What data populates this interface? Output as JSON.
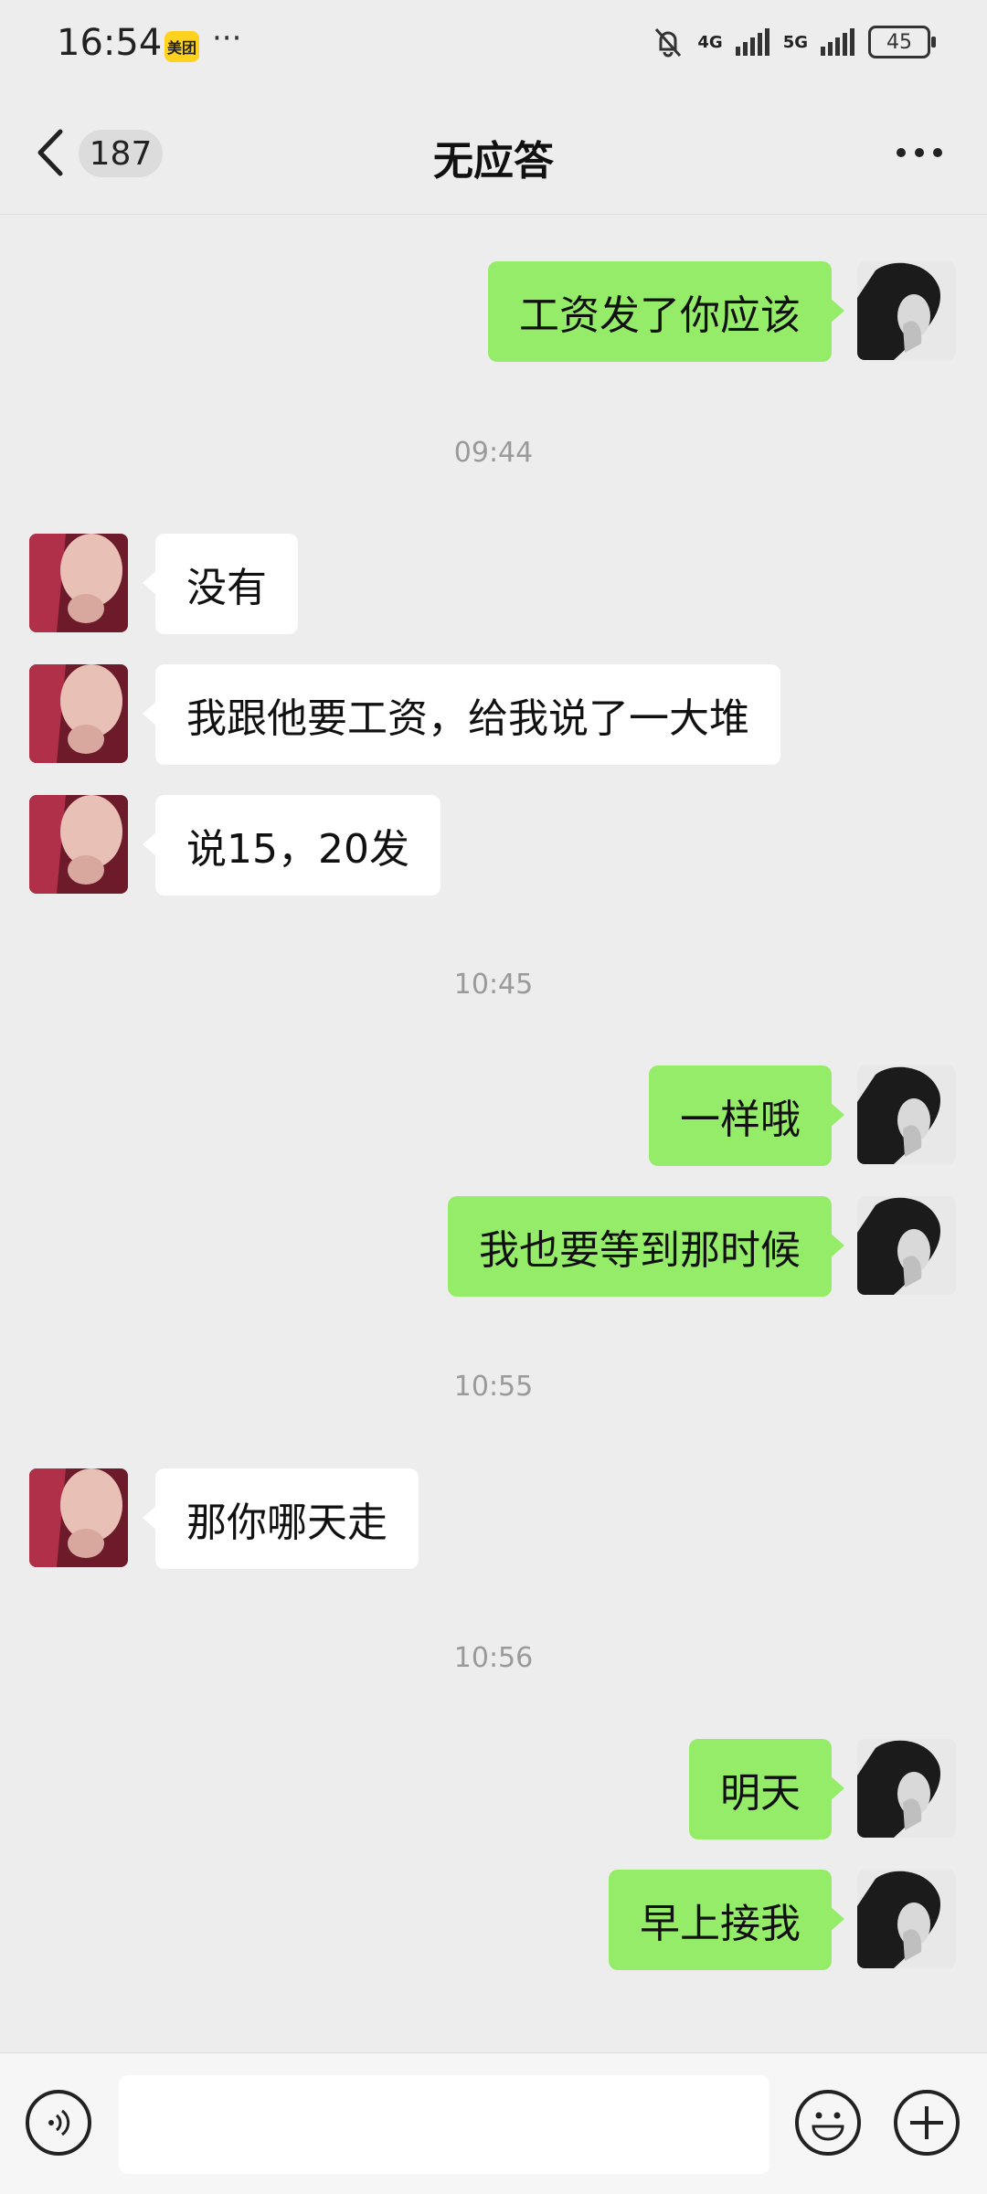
{
  "status_bar": {
    "time": "16:54",
    "app_badge": "美团",
    "dots": "···",
    "net_4g": "4G",
    "net_5g": "5G",
    "battery": "45"
  },
  "header": {
    "unread_count": "187",
    "title": "无应答"
  },
  "messages": [
    {
      "type": "out",
      "text": "工资发了你应该"
    },
    {
      "type": "time",
      "text": "09:44"
    },
    {
      "type": "in",
      "text": "没有"
    },
    {
      "type": "in",
      "text": "我跟他要工资，给我说了一大堆"
    },
    {
      "type": "in",
      "text": "说15，20发"
    },
    {
      "type": "time",
      "text": "10:45"
    },
    {
      "type": "out",
      "text": "一样哦"
    },
    {
      "type": "out",
      "text": "我也要等到那时候"
    },
    {
      "type": "time",
      "text": "10:55"
    },
    {
      "type": "in",
      "text": "那你哪天走"
    },
    {
      "type": "time",
      "text": "10:56"
    },
    {
      "type": "out",
      "text": "明天"
    },
    {
      "type": "out",
      "text": "早上接我"
    }
  ],
  "input": {
    "value": ""
  },
  "colors": {
    "outgoing_bubble": "#95ec69",
    "incoming_bubble": "#ffffff",
    "background": "#ededed"
  }
}
